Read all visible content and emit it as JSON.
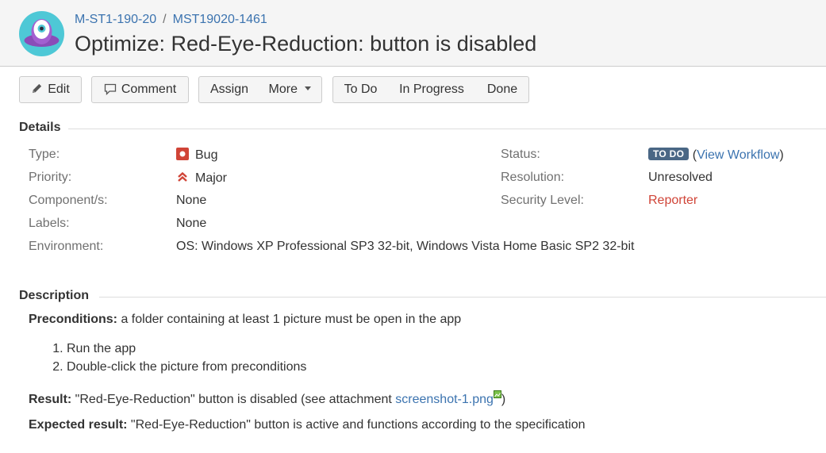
{
  "header": {
    "project_key": "M-ST1-190-20",
    "separator": "/",
    "issue_key": "MST19020-1461",
    "title": "Optimize: Red-Eye-Reduction: button is disabled"
  },
  "toolbar": {
    "edit": "Edit",
    "comment": "Comment",
    "assign": "Assign",
    "more": "More",
    "todo": "To Do",
    "in_progress": "In Progress",
    "done": "Done"
  },
  "details": {
    "heading": "Details",
    "type_label": "Type:",
    "type_value": "Bug",
    "priority_label": "Priority:",
    "priority_value": "Major",
    "components_label": "Component/s:",
    "components_value": "None",
    "labels_label": "Labels:",
    "labels_value": "None",
    "environment_label": "Environment:",
    "environment_value": "OS: Windows XP Professional SP3 32-bit, Windows Vista Home Basic SP2 32-bit",
    "status_label": "Status:",
    "status_value": "TO DO",
    "status_open_paren": "(",
    "view_workflow": "View Workflow",
    "status_close_paren": ")",
    "resolution_label": "Resolution:",
    "resolution_value": "Unresolved",
    "security_label": "Security Level:",
    "security_value": "Reporter"
  },
  "description": {
    "heading": "Description",
    "preconditions_label": "Preconditions:",
    "preconditions_text": " a folder containing at least 1 picture must be open in the app",
    "steps": [
      "Run the app",
      "Double-click the picture from preconditions"
    ],
    "result_label": "Result:",
    "result_text": " \"Red-Eye-Reduction\" button is disabled (see attachment ",
    "attachment": "screenshot-1.png",
    "result_close": ")",
    "expected_label": "Expected result:",
    "expected_text": " \"Red-Eye-Reduction\" button is active and functions according to the specification"
  },
  "colors": {
    "link": "#3b73af",
    "status_lozenge": "#4a6785",
    "bug_icon": "#d04437",
    "priority_icon": "#d04437",
    "security_value": "#d04437"
  },
  "icons": {
    "avatar": "project-avatar-icon",
    "edit": "pencil-icon",
    "comment": "comment-bubble-icon",
    "more": "caret-down-icon",
    "type": "bug-icon",
    "priority": "major-priority-icon",
    "attachment": "image-attachment-icon"
  }
}
